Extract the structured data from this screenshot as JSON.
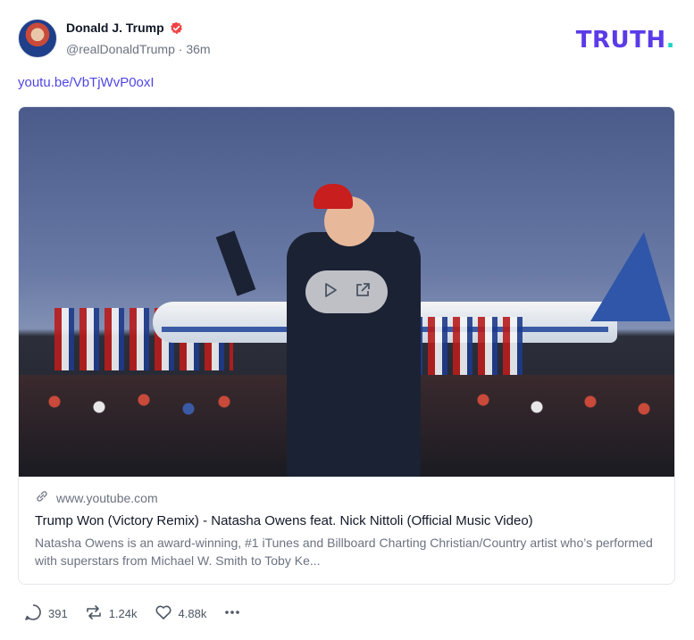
{
  "author": {
    "name": "Donald J. Trump",
    "handle": "@realDonaldTrump",
    "time": "36m",
    "separator": "·"
  },
  "brand": {
    "logo_text": "TRUTH",
    "logo_dot": "."
  },
  "post": {
    "link_text": "youtu.be/VbTjWvP0oxI"
  },
  "link_card": {
    "domain": "www.youtube.com",
    "title": "Trump Won (Victory Remix) - Natasha Owens feat. Nick Nittoli (Official Music Video)",
    "description": "Natasha Owens is an award-winning, #1 iTunes and Billboard Charting Christian/Country artist who’s performed with superstars from Michael W. Smith to Toby Ke..."
  },
  "actions": {
    "replies": "391",
    "retruths": "1.24k",
    "likes": "4.88k"
  },
  "colors": {
    "brand_purple": "#5b3be8",
    "brand_teal": "#19d4c2",
    "link": "#4f46e5",
    "verified": "#ef4444"
  },
  "icons": [
    "verified-badge-icon",
    "play-icon",
    "external-link-icon",
    "link-icon",
    "reply-icon",
    "retruth-icon",
    "like-icon",
    "more-icon"
  ]
}
